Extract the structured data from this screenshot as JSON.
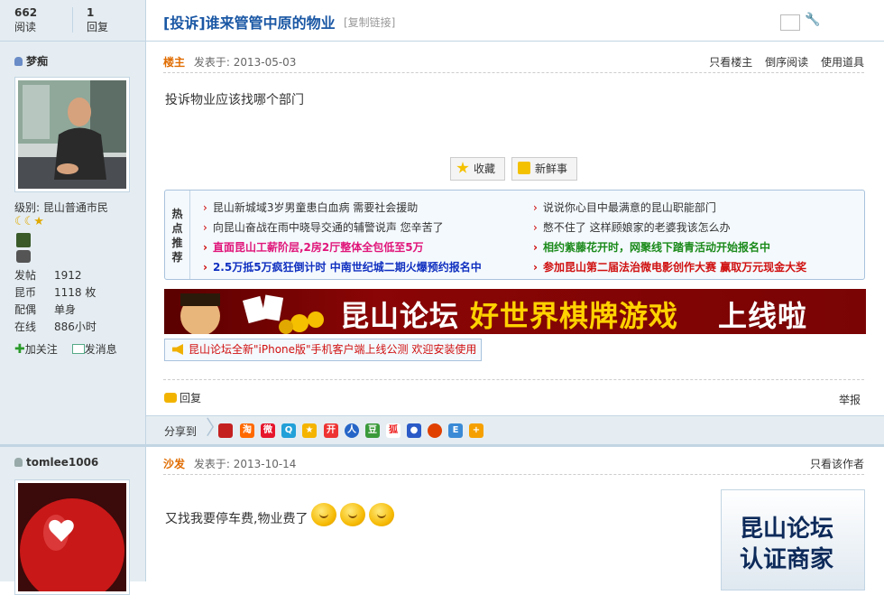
{
  "thread": {
    "views": "662",
    "views_label": "阅读",
    "replies": "1",
    "replies_label": "回复",
    "title": "[投诉]谁来管管中原的物业",
    "copy_link": "[复制链接]"
  },
  "post1": {
    "author": "梦痴",
    "level": "级别: 昆山普通市民",
    "stats": [
      {
        "k": "发帖",
        "v": "1912"
      },
      {
        "k": "昆币",
        "v": "1118 枚"
      },
      {
        "k": "配偶",
        "v": "单身"
      },
      {
        "k": "在线",
        "v": "886小时"
      }
    ],
    "follow": "加关注",
    "message": "发消息",
    "floor": "楼主",
    "posted": "发表于: 2013-05-03",
    "tools": [
      "只看楼主",
      "倒序阅读",
      "使用道具"
    ],
    "content": "投诉物业应该找哪个部门",
    "fav": "收藏",
    "news": "新鲜事",
    "hot_label": "热点推荐",
    "hot_links": [
      "昆山新城域3岁男童患白血病 需要社会援助",
      "说说你心目中最满意的昆山职能部门",
      "向昆山奋战在雨中晓导交通的辅警说声 您辛苦了",
      "憋不住了 这样顾娘家的老婆我该怎么办",
      "直面昆山工薪阶层,2房2厅整体全包低至5万",
      "相约紫藤花开时，网聚线下踏青活动开始报名中",
      "2.5万抵5万疯狂倒计时 中南世纪城二期火爆预约报名中",
      "参加昆山第二届法治微电影创作大赛 赢取万元现金大奖"
    ],
    "banner_a": "昆山论坛",
    "banner_b": "好世界棋牌游戏",
    "banner_c": "上线啦",
    "notice": "昆山论坛全新\"iPhone版\"手机客户端上线公测 欢迎安装使用",
    "reply": "回复",
    "report": "举报",
    "share": "分享到"
  },
  "post2": {
    "author": "tomlee1006",
    "floor": "沙发",
    "posted": "发表于: 2013-10-14",
    "tools": "只看该作者",
    "content": "又找我要停车费,物业费了",
    "ad_line1": "昆山论坛",
    "ad_line2": "认证商家"
  },
  "colors": {
    "accent": "#1a57a4",
    "side_bg": "#e5edf2",
    "floor": "#e06c00"
  }
}
